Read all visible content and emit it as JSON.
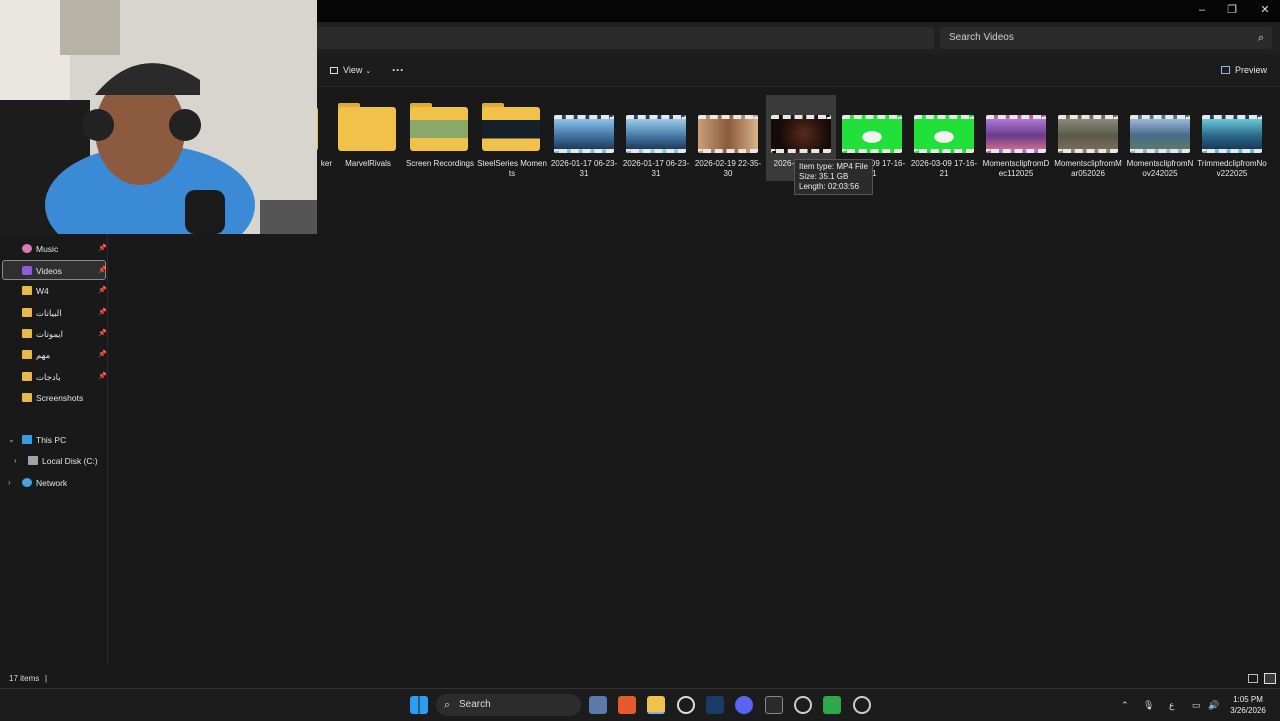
{
  "window": {
    "minimize": "–",
    "maximize": "❐",
    "close": "✕"
  },
  "search": {
    "placeholder": "Search Videos"
  },
  "toolbar": {
    "view_label": "View",
    "more": "···",
    "preview_label": "Preview"
  },
  "sidebar": {
    "items": [
      {
        "label": "Music",
        "pinned": true
      },
      {
        "label": "Videos",
        "pinned": true,
        "selected": true
      },
      {
        "label": "W4",
        "pinned": true
      },
      {
        "label": "البيانات",
        "pinned": true
      },
      {
        "label": "ايموتات",
        "pinned": true
      },
      {
        "label": "مهم",
        "pinned": true
      },
      {
        "label": "بادجات",
        "pinned": true
      },
      {
        "label": "Screenshots",
        "pinned": false
      }
    ],
    "this_pc": "This PC",
    "local_disk": "Local Disk (C:)",
    "network": "Network"
  },
  "files": [
    {
      "name": "ker",
      "type": "folder"
    },
    {
      "name": "MarvelRivals",
      "type": "folder"
    },
    {
      "name": "Screen Recordings",
      "type": "folder"
    },
    {
      "name": "SteelSeries Moments",
      "type": "folder"
    },
    {
      "name": "2026-01-17 06-23-31",
      "type": "video"
    },
    {
      "name": "2026-01-17 06-23-31",
      "type": "video"
    },
    {
      "name": "2026-02-19 22-35-30",
      "type": "video"
    },
    {
      "name": "2026-03-10 22-",
      "type": "video",
      "hovered": true
    },
    {
      "name": "2026-03-09 17-16-21",
      "type": "video"
    },
    {
      "name": "2026-03-09 17-16-21",
      "type": "video"
    },
    {
      "name": "MomentsclipfromDec112025",
      "type": "video"
    },
    {
      "name": "MomentsclipfromMar052026",
      "type": "video"
    },
    {
      "name": "MomentsclipfromNov242025",
      "type": "video"
    },
    {
      "name": "TrimmedclipfromNov222025",
      "type": "video"
    }
  ],
  "tooltip": {
    "type_line": "Item type: MP4 File",
    "size_line": "Size: 35.1 GB",
    "length_line": "Length: 02:03:56"
  },
  "status": {
    "count": "17 items"
  },
  "taskbar": {
    "search_label": "Search",
    "time": "1:05 PM",
    "date": "3/26/2026",
    "lang": "ع"
  },
  "colors": {
    "folder": "#f0c24a",
    "background": "#191919",
    "green_screen": "#22e03a"
  }
}
